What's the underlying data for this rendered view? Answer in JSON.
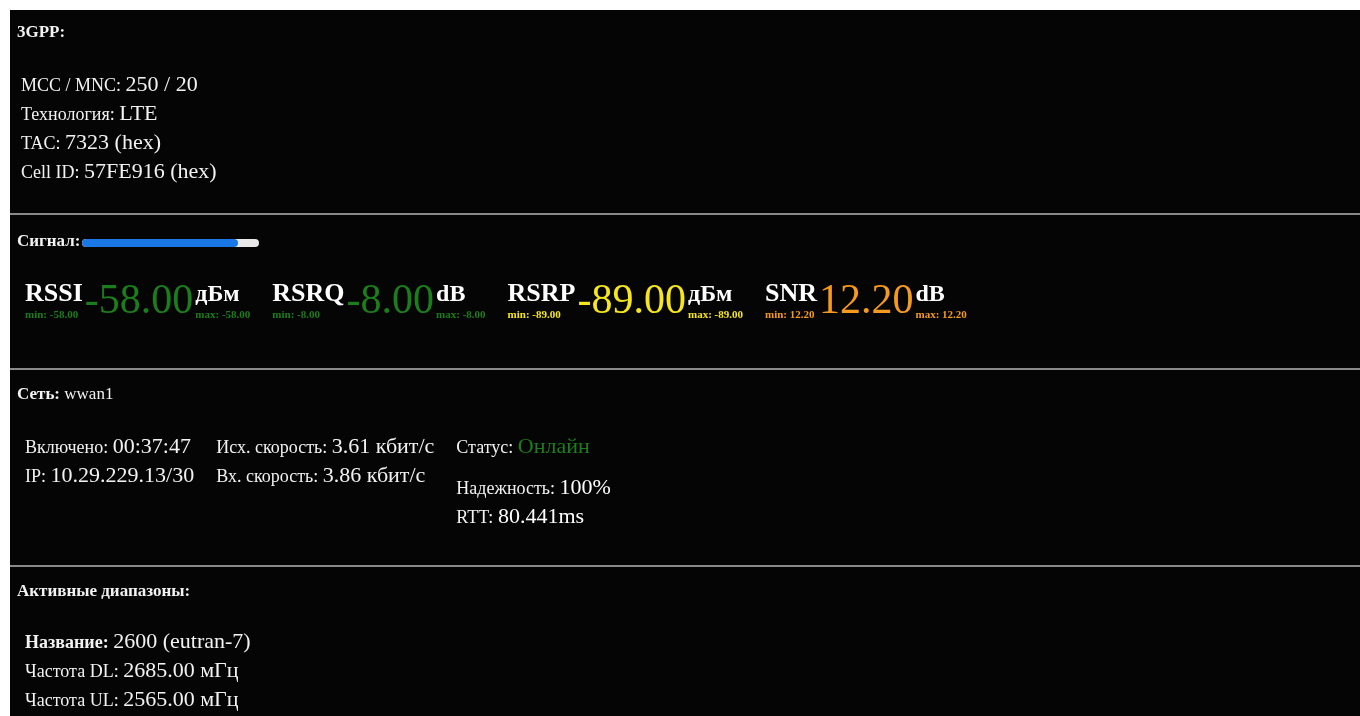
{
  "gpp": {
    "title": "3GPP:",
    "fields": [
      {
        "label": "MCC / MNC:",
        "value": "250 / 20"
      },
      {
        "label": "Технология:",
        "value": "LTE"
      },
      {
        "label": "TAC:",
        "value": "7323 (hex)"
      },
      {
        "label": "Cell ID:",
        "value": "57FE916 (hex)"
      }
    ]
  },
  "signal": {
    "title": "Сигнал:",
    "level": 0.88,
    "metrics": [
      {
        "name": "RSSI",
        "value": "-58.00",
        "unit": "дБм",
        "min": "min: -58.00",
        "max": "max: -58.00",
        "color": "#1b7d1b"
      },
      {
        "name": "RSRQ",
        "value": "-8.00",
        "unit": "dB",
        "min": "min: -8.00",
        "max": "max: -8.00",
        "color": "#1b7d1b"
      },
      {
        "name": "RSRP",
        "value": "-89.00",
        "unit": "дБм",
        "min": "min: -89.00",
        "max": "max: -89.00",
        "color": "#f5e61e"
      },
      {
        "name": "SNR",
        "value": "12.20",
        "unit": "dB",
        "min": "min: 12.20",
        "max": "max: 12.20",
        "color": "#f59a1e"
      }
    ]
  },
  "network": {
    "title": "Сеть:",
    "name": "wwan1",
    "columns": [
      [
        {
          "label": "Включено:",
          "value": "00:37:47"
        },
        {
          "label": "IP:",
          "value": "10.29.229.13/30"
        }
      ],
      [
        {
          "label": "Исх. скорость:",
          "value": "3.61 кбит/с"
        },
        {
          "label": "Вх. скорость:",
          "value": "3.86 кбит/с"
        }
      ],
      [
        {
          "label": "Статус:",
          "value": "Онлайн",
          "color": "#1b7d1b"
        },
        {
          "label": "Надежность:",
          "value": "100%",
          "color": "#ffffff"
        },
        {
          "label": "RTT:",
          "value": "80.441ms",
          "color": "#ffffff"
        }
      ]
    ]
  },
  "bands": {
    "title": "Активные диапазоны:",
    "fields": [
      {
        "label": "Название:",
        "value": "2600 (eutran-7)",
        "kind": "bold"
      },
      {
        "label": "Частота DL:",
        "value": "2685.00 мГц",
        "kind": "plain"
      },
      {
        "label": "Частота UL:",
        "value": "2565.00 мГц",
        "kind": "plain"
      }
    ]
  }
}
